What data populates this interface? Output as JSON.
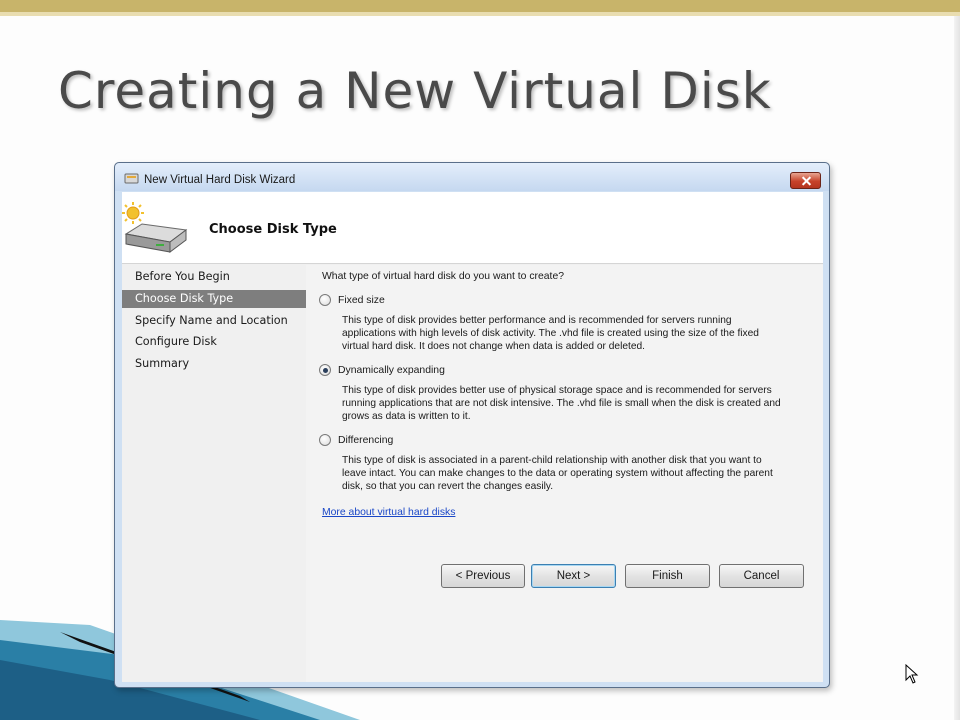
{
  "slide": {
    "title": "Creating a New Virtual Disk"
  },
  "dialog": {
    "window_title": "New Virtual Hard Disk Wizard",
    "header_title": "Choose Disk Type",
    "steps": [
      {
        "label": "Before You Begin",
        "active": false
      },
      {
        "label": "Choose Disk Type",
        "active": true
      },
      {
        "label": "Specify Name and Location",
        "active": false
      },
      {
        "label": "Configure Disk",
        "active": false
      },
      {
        "label": "Summary",
        "active": false
      }
    ],
    "question": "What type of virtual hard disk do you want to create?",
    "options": [
      {
        "label": "Fixed size",
        "checked": false,
        "description_lines": [
          "This type of disk provides better performance and is recommended for servers running",
          "applications with high levels of disk activity. The .vhd file is created using the size of the fixed",
          "virtual hard disk. It does not change when data is added or deleted."
        ]
      },
      {
        "label": "Dynamically expanding",
        "checked": true,
        "description_lines": [
          "This type of disk provides better use of physical storage space and is recommended for servers",
          "running applications that are not disk intensive. The .vhd file is small when the disk is created and",
          "grows as data is written to it."
        ]
      },
      {
        "label": "Differencing",
        "checked": false,
        "description_lines": [
          "This type of disk is associated in a parent-child relationship with another disk that you want to",
          "leave intact. You can make changes to the data or operating system without affecting the parent",
          "disk, so that you can revert the changes easily."
        ]
      }
    ],
    "help_link": "More about virtual hard disks",
    "buttons": {
      "previous": "< Previous",
      "next": "Next >",
      "finish": "Finish",
      "cancel": "Cancel"
    }
  },
  "colors": {
    "accent_band": "#c8b46a",
    "swoosh_teal": "#2a7fa6",
    "active_step": "#7e7e7e",
    "link": "#1a47c7"
  }
}
